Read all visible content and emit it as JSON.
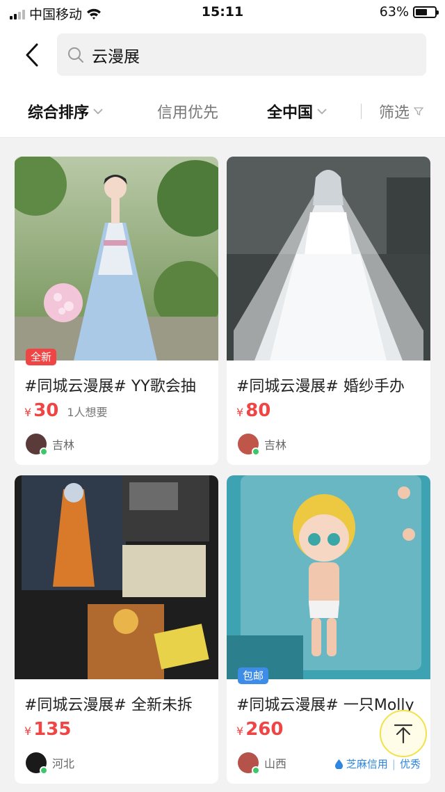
{
  "status_bar": {
    "carrier": "中国移动",
    "time": "15:11",
    "battery": "63%",
    "battery_level": 0.63
  },
  "search": {
    "query": "云漫展"
  },
  "filters": {
    "sort": "综合排序",
    "credit": "信用优先",
    "region": "全中国",
    "filter": "筛选"
  },
  "items": [
    {
      "title": "#同城云漫展# YY歌会抽",
      "currency": "¥",
      "price": "30",
      "wants": "1人想要",
      "badge": "全新",
      "location": "吉林",
      "credit": "",
      "rating": ""
    },
    {
      "title": "#同城云漫展# 婚纱手办",
      "currency": "¥",
      "price": "80",
      "wants": "",
      "badge": "",
      "location": "吉林",
      "credit": "",
      "rating": ""
    },
    {
      "title": "#同城云漫展# 全新未拆",
      "currency": "¥",
      "price": "135",
      "wants": "",
      "badge": "",
      "location": "河北",
      "credit": "",
      "rating": ""
    },
    {
      "title": "#同城云漫展# 一只Molly",
      "currency": "¥",
      "price": "260",
      "wants": "",
      "badge": "包邮",
      "location": "山西",
      "credit": "芝麻信用",
      "rating": "优秀"
    }
  ],
  "colors": {
    "accent": "#f04545",
    "online": "#3cc86a",
    "credit_blue": "#2f86e0",
    "back_top_ring": "#f2e14b"
  }
}
